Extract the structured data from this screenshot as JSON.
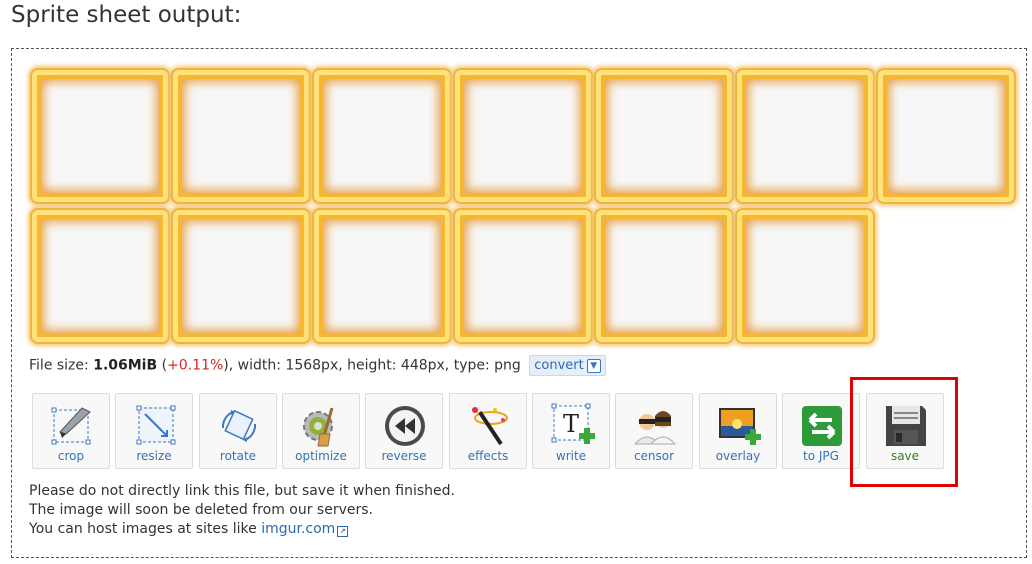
{
  "page": {
    "title": "Sprite sheet output:"
  },
  "sprite_sheet": {
    "row1_count": 7,
    "row2_count": 6
  },
  "meta": {
    "file_size_label": "File size:",
    "file_size": "1.06MiB",
    "size_change_open": "(",
    "size_change": "+0.11%",
    "size_change_close": ")",
    "rest": ", width: 1568px, height: 448px, type: png",
    "convert_label": "convert"
  },
  "tools": [
    {
      "name": "crop",
      "label": "crop",
      "icon": "crop-icon"
    },
    {
      "name": "resize",
      "label": "resize",
      "icon": "resize-icon"
    },
    {
      "name": "rotate",
      "label": "rotate",
      "icon": "rotate-icon"
    },
    {
      "name": "optimize",
      "label": "optimize",
      "icon": "optimize-icon"
    },
    {
      "name": "reverse",
      "label": "reverse",
      "icon": "reverse-icon"
    },
    {
      "name": "effects",
      "label": "effects",
      "icon": "effects-icon"
    },
    {
      "name": "write",
      "label": "write",
      "icon": "write-icon"
    },
    {
      "name": "censor",
      "label": "censor",
      "icon": "censor-icon"
    },
    {
      "name": "overlay",
      "label": "overlay",
      "icon": "overlay-icon"
    },
    {
      "name": "to-jpg",
      "label": "to JPG",
      "icon": "to-jpg-icon"
    },
    {
      "name": "save",
      "label": "save",
      "icon": "save-icon"
    }
  ],
  "notes": {
    "line1": "Please do not directly link this file, but save it when finished.",
    "line2": "The image will soon be deleted from our servers.",
    "line3_prefix": "You can host images at sites like ",
    "link": "imgur.com"
  },
  "colors": {
    "highlight": "#e00000",
    "link": "#2a6ab3",
    "size_change": "#d22222"
  }
}
